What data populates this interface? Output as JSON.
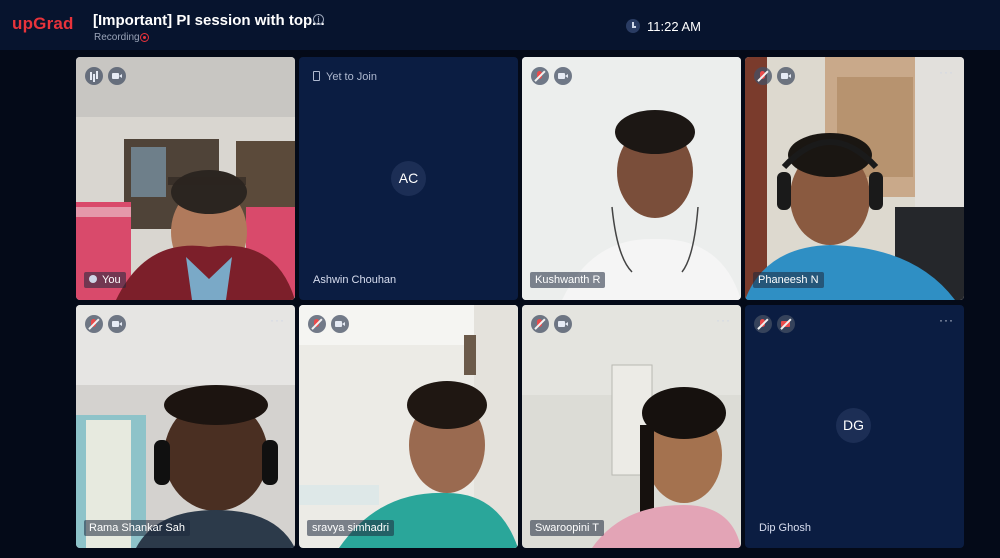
{
  "header": {
    "logo": "upGrad",
    "title": "[Important] PI session with top...",
    "info_icon": "info-icon",
    "recording_label": "Recording",
    "recording_color": "#e8333b",
    "time": "11:22 AM"
  },
  "tiles": [
    {
      "name": "You",
      "video": true,
      "mic": "on",
      "cam": "on"
    },
    {
      "name": "Ashwin Chouhan",
      "video": false,
      "status": "Yet to Join",
      "initials": "AC"
    },
    {
      "name": "Kushwanth R",
      "video": true,
      "mic": "off",
      "cam": "on"
    },
    {
      "name": "Phaneesh N",
      "video": true,
      "mic": "off",
      "cam": "on"
    },
    {
      "name": "Rama Shankar Sah",
      "video": true,
      "mic": "off",
      "cam": "on"
    },
    {
      "name": "sravya simhadri",
      "video": true,
      "mic": "off",
      "cam": "on"
    },
    {
      "name": "Swaroopini T",
      "video": true,
      "mic": "off",
      "cam": "on"
    },
    {
      "name": "Dip Ghosh",
      "video": false,
      "mic": "off",
      "cam": "off",
      "initials": "DG"
    }
  ],
  "colors": {
    "background": "#040a18",
    "topbar": "#07142e",
    "tile_placeholder": "#0b1d42",
    "brand_red": "#e8333b"
  }
}
